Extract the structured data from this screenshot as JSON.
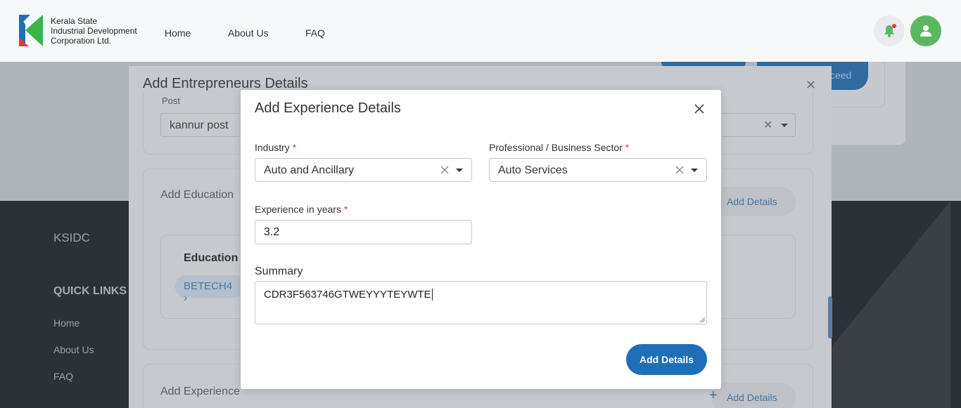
{
  "header": {
    "logo_line1": "Kerala State",
    "logo_line2": "Industrial Development",
    "logo_line3": "Corporation Ltd.",
    "nav": [
      {
        "label": "Home"
      },
      {
        "label": "About Us"
      },
      {
        "label": "FAQ"
      }
    ],
    "icons": {
      "notification": "bell-icon",
      "profile": "user-icon"
    },
    "colors": {
      "avatar": "#5cb860",
      "notify_dot": "#e53935"
    }
  },
  "background": {
    "proceed_label": "ceed",
    "footer": {
      "brand": "KSIDC",
      "quick_links_title": "QUICK LINKS",
      "links": [
        {
          "label": "Home"
        },
        {
          "label": "About Us"
        },
        {
          "label": "FAQ"
        }
      ]
    }
  },
  "entrepreneur_modal": {
    "title": "Add Entrepreneurs Details",
    "post_label": "Post",
    "post_value": "kannur post",
    "education_section": "Add Education",
    "education_head": "Education",
    "education_chip": "BETECH4",
    "experience_section": "Add Experience",
    "add_details_label": "Add Details"
  },
  "experience_modal": {
    "title": "Add Experience Details",
    "industry": {
      "label": "Industry",
      "value": "Auto and Ancillary"
    },
    "sector": {
      "label": "Professional / Business Sector",
      "value": "Auto Services"
    },
    "experience": {
      "label": "Experience in years",
      "value": "3.2"
    },
    "summary": {
      "label": "Summary",
      "value": "CDR3F563746GTWEYYYTEYWTE"
    },
    "required_mark": "*",
    "submit_label": "Add Details",
    "colors": {
      "primary": "#1e6fb8",
      "required": "#e53935"
    }
  }
}
